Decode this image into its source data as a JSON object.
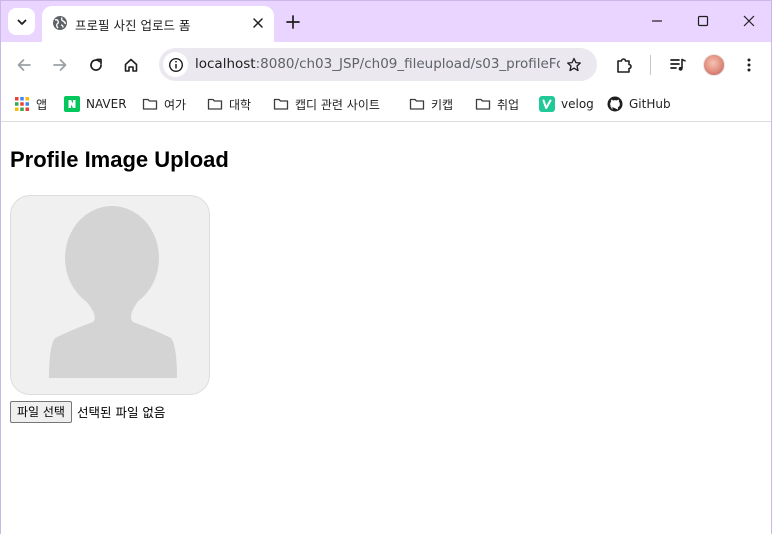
{
  "tab": {
    "title": "프로필 사진 업로드 폼"
  },
  "toolbar": {
    "url_host": "localhost",
    "url_path": ":8080/ch03_JSP/ch09_fileupload/s03_profileFor..."
  },
  "bookmarks": [
    {
      "label": "앱",
      "icon": "apps-grid-icon"
    },
    {
      "label": "NAVER",
      "icon": "naver-icon"
    },
    {
      "label": "여가",
      "icon": "folder-icon"
    },
    {
      "label": "대학",
      "icon": "folder-icon"
    },
    {
      "label": "캡디 관련 사이트",
      "icon": "folder-icon"
    },
    {
      "label": "키캡",
      "icon": "folder-icon"
    },
    {
      "label": "취업",
      "icon": "folder-icon"
    },
    {
      "label": "velog",
      "icon": "velog-icon"
    },
    {
      "label": "GitHub",
      "icon": "github-icon"
    }
  ],
  "page": {
    "title": "Profile Image Upload",
    "file_button_label": "파일 선택",
    "file_status": "선택된 파일 없음"
  },
  "colors": {
    "tabstrip": "#e9d5ff",
    "naver": "#03c75a",
    "velog": "#20c997",
    "silhouette": "#d4d4d4"
  }
}
